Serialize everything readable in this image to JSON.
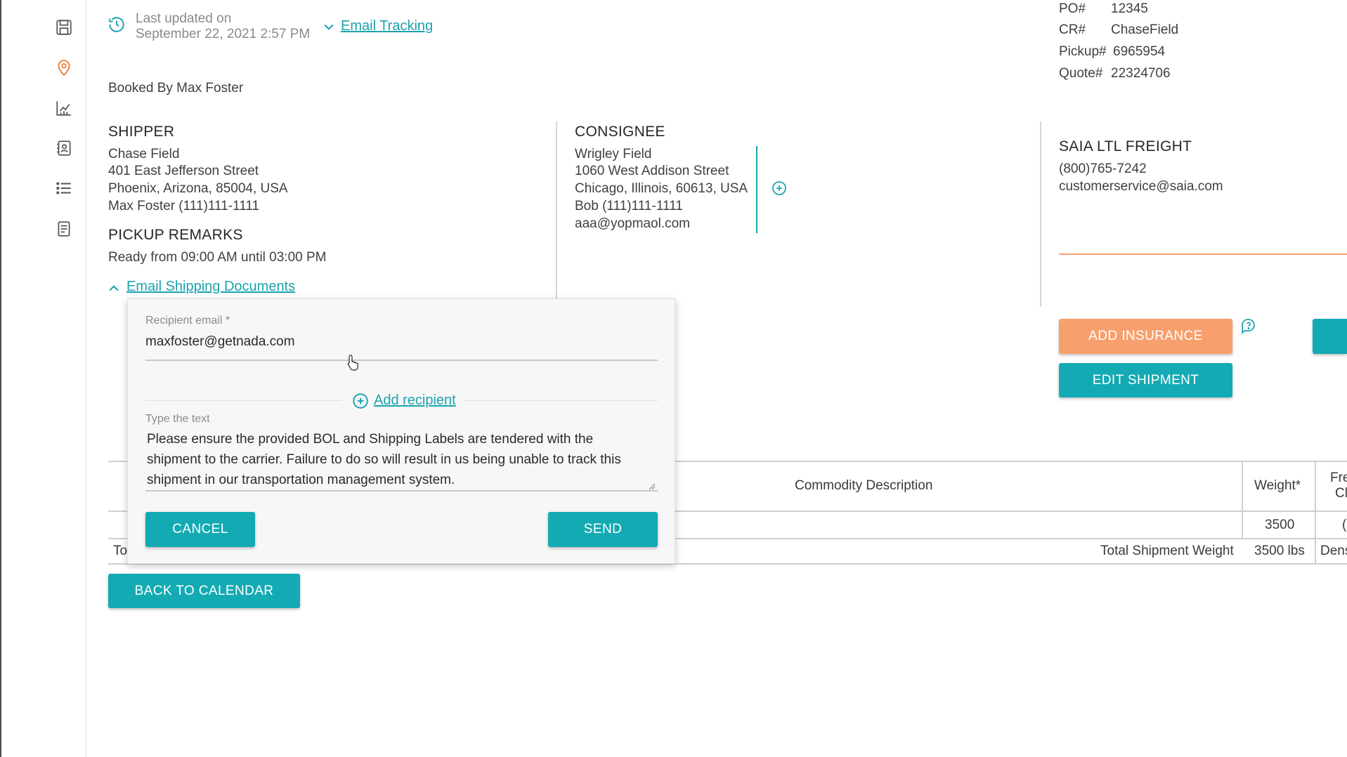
{
  "sidebar": {
    "icons": [
      {
        "name": "save-icon"
      },
      {
        "name": "location-pin-icon",
        "color": "#f07f3c"
      },
      {
        "name": "chart-icon"
      },
      {
        "name": "contacts-icon"
      },
      {
        "name": "list-icon"
      },
      {
        "name": "document-icon"
      }
    ]
  },
  "header": {
    "last_updated_label": "Last updated on",
    "last_updated_date": "September 22, 2021 2:57 PM",
    "email_tracking_link": "Email Tracking",
    "booked_by": "Booked By Max Foster"
  },
  "references": {
    "po_label": "PO#",
    "po_value": "12345",
    "cr_label": "CR#",
    "cr_value": "ChaseField",
    "pickup_label": "Pickup#",
    "pickup_value": "6965954",
    "quote_label": "Quote#",
    "quote_value": "22324706"
  },
  "shipper": {
    "heading": "SHIPPER",
    "name": "Chase Field",
    "street": "401 East Jefferson Street",
    "city": "Phoenix, Arizona, 85004, USA",
    "contact": "Max Foster (111)111-1111"
  },
  "pickup_remarks": {
    "heading": "PICKUP REMARKS",
    "text": "Ready from 09:00 AM until 03:00 PM"
  },
  "email_docs_link": "Email Shipping Documents",
  "consignee": {
    "heading": "CONSIGNEE",
    "name": "Wrigley Field",
    "street": "1060 West Addison Street",
    "city": "Chicago, Illinois, 60613, USA",
    "contact": "Bob (111)111-1111",
    "email": "aaa@yopmaol.com"
  },
  "carrier": {
    "name": "SAIA LTL FREIGHT",
    "phone": "(800)765-7242",
    "email": "customerservice@saia.com"
  },
  "actions": {
    "add_insurance": "ADD INSURANCE",
    "edit_shipment": "EDIT SHIPMENT",
    "back_to_calendar": "BACK TO CALENDAR"
  },
  "table": {
    "commodity_header": "Commodity Description",
    "weight_header": "Weight*",
    "freight_header_partial_1": "Fre",
    "freight_header_partial_2": "Cl",
    "row_weight": "3500",
    "row_partial": "(",
    "total_label_partial": "To",
    "total_weight_label": "Total Shipment Weight",
    "total_weight_value": "3500 lbs",
    "density_partial": "Dens"
  },
  "email_modal": {
    "recipient_label": "Recipient email *",
    "recipient_value": "maxfoster@getnada.com",
    "add_recipient": "Add recipient",
    "text_label": "Type the text",
    "message_line_1": "Please ensure the provided BOL and Shipping Labels are tendered with the",
    "message_line_2": "shipment to the carrier. Failure to do so will result in us being unable to track this",
    "message_line_3": "shipment in our transportation management system.",
    "cancel": "CANCEL",
    "send": "SEND"
  },
  "colors": {
    "accent": "#14aab3",
    "orange": "#f7a06d",
    "divider_orange": "#f5a26a"
  }
}
